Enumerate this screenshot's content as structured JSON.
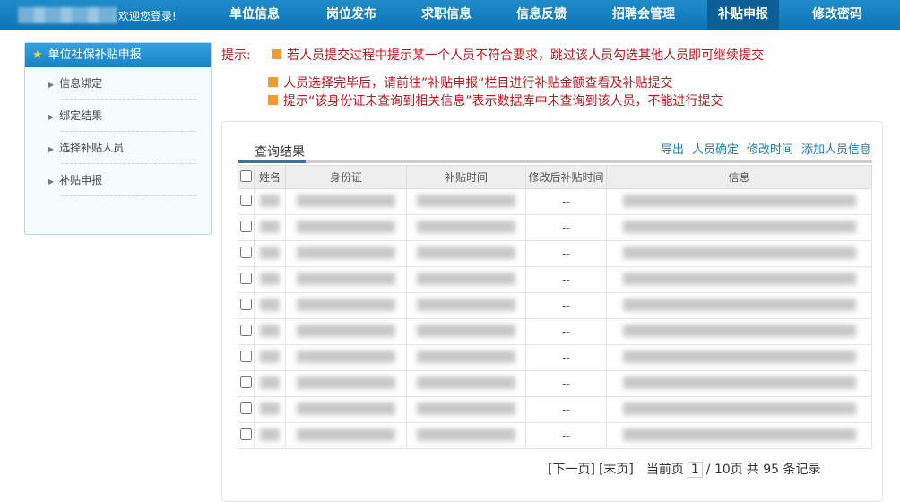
{
  "header": {
    "welcome": "欢迎您登录!",
    "nav": [
      {
        "label": "单位信息"
      },
      {
        "label": "岗位发布"
      },
      {
        "label": "求职信息"
      },
      {
        "label": "信息反馈"
      },
      {
        "label": "招聘会管理"
      },
      {
        "label": "补贴申报",
        "active": true
      },
      {
        "label": "修改密码"
      }
    ]
  },
  "sidebar": {
    "title": "单位社保补贴申报",
    "items": [
      {
        "label": "信息绑定"
      },
      {
        "label": "绑定结果"
      },
      {
        "label": "选择补贴人员"
      },
      {
        "label": "补贴申报"
      }
    ]
  },
  "tips": {
    "label": "提示:",
    "lines": [
      "若人员提交过程中提示某一个人员不符合要求，跳过该人员勾选其他人员即可继续提交",
      "人员选择完毕后，请前往”补贴申报“栏目进行补贴金额查看及补贴提交",
      "提示“该身份证未查询到相关信息”表示数据库中未查询到该人员，不能进行提交"
    ]
  },
  "results": {
    "title": "查询结果",
    "actions": [
      "导出",
      "人员确定",
      "修改时间",
      "添加人员信息"
    ],
    "columns": [
      "姓名",
      "身份证",
      "补贴时间",
      "修改后补贴时间",
      "信息"
    ],
    "modified_time": "--",
    "row_count": 10
  },
  "pager": {
    "next": "[下一页]",
    "last": "[末页]",
    "current_label": "当前页",
    "current": "1",
    "total_pages": "/ 10页",
    "total": "共 95 条记录"
  },
  "colors": {
    "nav_bg": "#1583c6",
    "tip_red": "#c0161c",
    "link": "#1d7db4",
    "bullet": "#f29a2e"
  }
}
